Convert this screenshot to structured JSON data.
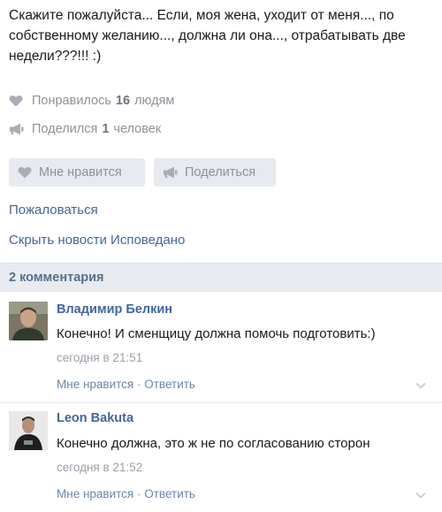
{
  "post": {
    "text": "Скажите пожалуйста... Если, моя жена, уходит от меня..., по собственному желанию..., должна ли она..., отрабатывать две недели???!!! :)"
  },
  "stats": {
    "likes_prefix": "Понравилось",
    "likes_count": "16",
    "likes_suffix": "людям",
    "shares_prefix": "Поделился",
    "shares_count": "1",
    "shares_suffix": "человек"
  },
  "actions": {
    "like_label": "Мне нравится",
    "share_label": "Поделиться"
  },
  "links": {
    "report": "Пожаловаться",
    "hide": "Скрыть новости Исповедано"
  },
  "comments_header": "2 комментария",
  "comments": [
    {
      "author": "Владимир Белкин",
      "text": "Конечно! И сменщицу должна помочь подготовить:)",
      "time": "сегодня в 21:51",
      "like_label": "Мне нравится",
      "separator": " · ",
      "reply_label": "Ответить"
    },
    {
      "author": "Leon Bakuta",
      "text": "Конечно должна, это ж не по согласованию сторон",
      "time": "сегодня в 21:52",
      "like_label": "Мне нравится",
      "separator": " · ",
      "reply_label": "Ответить"
    }
  ],
  "icons": {
    "heart": "heart-icon",
    "megaphone": "megaphone-icon",
    "chevron": "chevron-down-icon"
  },
  "colors": {
    "link": "#43679b",
    "muted": "#8c939b",
    "button_bg": "#e7eaee",
    "header_bg": "#e8ecf0"
  }
}
